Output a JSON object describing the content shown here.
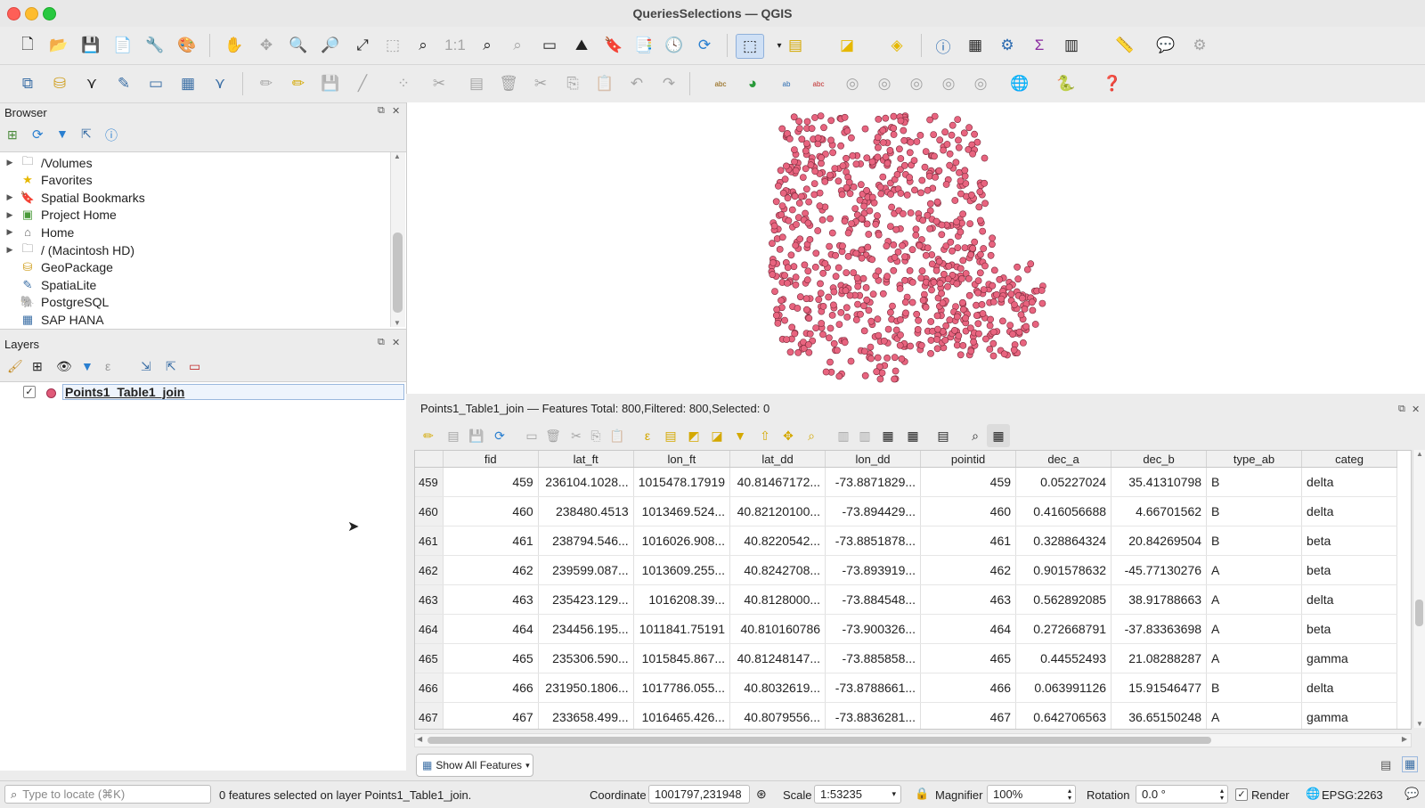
{
  "window": {
    "title": "QueriesSelections — QGIS"
  },
  "browser": {
    "title": "Browser",
    "items": [
      {
        "label": "/Volumes",
        "icon": "folder-icon",
        "expandable": true
      },
      {
        "label": "Favorites",
        "icon": "star-icon",
        "expandable": false
      },
      {
        "label": "Spatial Bookmarks",
        "icon": "bookmark-icon",
        "expandable": true
      },
      {
        "label": "Project Home",
        "icon": "project-home-icon",
        "expandable": true
      },
      {
        "label": "Home",
        "icon": "home-icon",
        "expandable": true
      },
      {
        "label": "/ (Macintosh HD)",
        "icon": "folder-icon",
        "expandable": true
      },
      {
        "label": "GeoPackage",
        "icon": "geopackage-icon",
        "expandable": false
      },
      {
        "label": "SpatiaLite",
        "icon": "spatialite-icon",
        "expandable": false
      },
      {
        "label": "PostgreSQL",
        "icon": "postgresql-icon",
        "expandable": false
      },
      {
        "label": "SAP HANA",
        "icon": "sap-hana-icon",
        "expandable": false
      }
    ]
  },
  "layers": {
    "title": "Layers",
    "items": [
      {
        "label": "Points1_Table1_join",
        "checked": true,
        "color": "#e05a78"
      }
    ]
  },
  "map": {
    "point_color": "#e8647f",
    "point_stroke": "#7a2a3a"
  },
  "attribute_table": {
    "title": "Points1_Table1_join — Features Total: 800,Filtered: 800,Selected: 0",
    "columns": [
      "fid",
      "lat_ft",
      "lon_ft",
      "lat_dd",
      "lon_dd",
      "pointid",
      "dec_a",
      "dec_b",
      "type_ab",
      "categ"
    ],
    "rows": [
      [
        "459",
        "459",
        "236104.1028...",
        "1015478.17919",
        "40.81467172...",
        "-73.8871829...",
        "459",
        "0.05227024",
        "35.41310798",
        "B",
        "delta"
      ],
      [
        "460",
        "460",
        "238480.4513",
        "1013469.524...",
        "40.82120100...",
        "-73.894429...",
        "460",
        "0.416056688",
        "4.66701562",
        "B",
        "delta"
      ],
      [
        "461",
        "461",
        "238794.546...",
        "1016026.908...",
        "40.8220542...",
        "-73.8851878...",
        "461",
        "0.328864324",
        "20.84269504",
        "B",
        "beta"
      ],
      [
        "462",
        "462",
        "239599.087...",
        "1013609.255...",
        "40.8242708...",
        "-73.893919...",
        "462",
        "0.901578632",
        "-45.77130276",
        "A",
        "beta"
      ],
      [
        "463",
        "463",
        "235423.129...",
        "1016208.39...",
        "40.8128000...",
        "-73.884548...",
        "463",
        "0.562892085",
        "38.91788663",
        "A",
        "delta"
      ],
      [
        "464",
        "464",
        "234456.195...",
        "1011841.75191",
        "40.810160786",
        "-73.900326...",
        "464",
        "0.272668791",
        "-37.83363698",
        "A",
        "beta"
      ],
      [
        "465",
        "465",
        "235306.590...",
        "1015845.867...",
        "40.81248147...",
        "-73.885858...",
        "465",
        "0.44552493",
        "21.08288287",
        "A",
        "gamma"
      ],
      [
        "466",
        "466",
        "231950.1806...",
        "1017786.055...",
        "40.8032619...",
        "-73.8788661...",
        "466",
        "0.063991126",
        "15.91546477",
        "B",
        "delta"
      ],
      [
        "467",
        "467",
        "233658.499...",
        "1016465.426...",
        "40.8079556...",
        "-73.8836281...",
        "467",
        "0.642706563",
        "36.65150248",
        "A",
        "gamma"
      ]
    ],
    "show_all_label": "Show All Features"
  },
  "status": {
    "locate_placeholder": "Type to locate (⌘K)",
    "message": "0 features selected on layer Points1_Table1_join.",
    "coordinate_label": "Coordinate",
    "coordinate_value": "1001797,231948",
    "scale_label": "Scale",
    "scale_value": "1:53235",
    "magnifier_label": "Magnifier",
    "magnifier_value": "100%",
    "rotation_label": "Rotation",
    "rotation_value": "0.0 °",
    "render_label": "Render",
    "crs_label": "EPSG:2263"
  }
}
